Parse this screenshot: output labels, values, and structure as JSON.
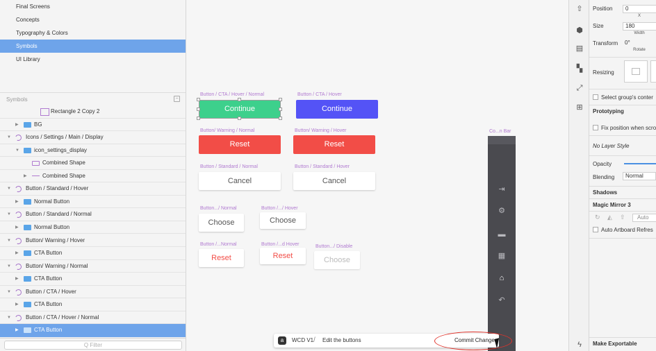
{
  "sidebar": {
    "pages": [
      {
        "label": "Final Screens",
        "selected": false
      },
      {
        "label": "Concepts",
        "selected": false
      },
      {
        "label": "Typography & Colors",
        "selected": false
      },
      {
        "label": "Symbols",
        "selected": true
      },
      {
        "label": "UI Library",
        "selected": false
      }
    ],
    "symbols_header": "Symbols",
    "layers": [
      {
        "label": "Rectangle 2 Copy 2",
        "indent": 3,
        "icon": "rectangle-icon",
        "arrow": "",
        "selected": false
      },
      {
        "label": "BG",
        "indent": 1,
        "icon": "folder-icon",
        "arrow": "▶",
        "selected": false
      },
      {
        "label": "Icons / Settings / Main / Display",
        "indent": 0,
        "icon": "symbol-icon",
        "arrow": "▼",
        "selected": false
      },
      {
        "label": "icon_settings_display",
        "indent": 1,
        "icon": "folder-icon",
        "arrow": "▼",
        "selected": false
      },
      {
        "label": "Combined Shape",
        "indent": 2,
        "icon": "shape-icon",
        "arrow": "",
        "selected": false
      },
      {
        "label": "Combined Shape",
        "indent": 2,
        "icon": "shape2-icon",
        "arrow": "▶",
        "selected": false
      },
      {
        "label": "Button / Standard / Hover",
        "indent": 0,
        "icon": "symbol-icon",
        "arrow": "▼",
        "selected": false
      },
      {
        "label": "Normal Button",
        "indent": 1,
        "icon": "folder-icon",
        "arrow": "▶",
        "selected": false
      },
      {
        "label": "Button / Standard / Normal",
        "indent": 0,
        "icon": "symbol-icon",
        "arrow": "▼",
        "selected": false
      },
      {
        "label": "Normal Button",
        "indent": 1,
        "icon": "folder-icon",
        "arrow": "▶",
        "selected": false
      },
      {
        "label": "Button/ Warning / Hover",
        "indent": 0,
        "icon": "symbol-icon",
        "arrow": "▼",
        "selected": false
      },
      {
        "label": "CTA Button",
        "indent": 1,
        "icon": "folder-icon",
        "arrow": "▶",
        "selected": false
      },
      {
        "label": "Button/ Warning / Normal",
        "indent": 0,
        "icon": "symbol-icon",
        "arrow": "▼",
        "selected": false
      },
      {
        "label": "CTA Button",
        "indent": 1,
        "icon": "folder-icon",
        "arrow": "▶",
        "selected": false
      },
      {
        "label": "Button / CTA / Hover",
        "indent": 0,
        "icon": "symbol-icon",
        "arrow": "▼",
        "selected": false
      },
      {
        "label": "CTA Button",
        "indent": 1,
        "icon": "folder-icon",
        "arrow": "▶",
        "selected": false
      },
      {
        "label": "Button / CTA / Hover / Normal",
        "indent": 0,
        "icon": "symbol-icon",
        "arrow": "▼",
        "selected": false
      },
      {
        "label": "CTA Button",
        "indent": 1,
        "icon": "folder-icon",
        "arrow": "▶",
        "selected": true
      }
    ],
    "filter_placeholder": "Q Filter"
  },
  "canvas": {
    "artboards": [
      {
        "caption": "Button / CTA / Hover / Normal",
        "label": "Continue",
        "style": "green"
      },
      {
        "caption": "Button / CTA / Hover",
        "label": "Continue",
        "style": "blue"
      },
      {
        "caption": "Button/ Warning / Normal",
        "label": "Reset",
        "style": "red"
      },
      {
        "caption": "Button/ Warning / Hover",
        "label": "Reset",
        "style": "red"
      },
      {
        "caption": "Button / Standard / Normal",
        "label": "Cancel",
        "style": "white"
      },
      {
        "caption": "Button / Standard / Hover",
        "label": "Cancel",
        "style": "white"
      },
      {
        "caption": "Button.../ Normal",
        "label": "Choose",
        "style": "white"
      },
      {
        "caption": "Button /.../ Hover",
        "label": "Choose",
        "style": "white"
      },
      {
        "caption": "Button /...Normal",
        "label": "Reset",
        "style": "white-red"
      },
      {
        "caption": "Button /...d Hover",
        "label": "Reset",
        "style": "white-red"
      },
      {
        "caption": "Button.../ Disable",
        "label": "Choose",
        "style": "disabled"
      }
    ],
    "bar_caption": "Co...n Bar",
    "bar_icons": [
      "login-icon",
      "gear-icon",
      "window-icon",
      "grid-icon",
      "home-icon",
      "back-icon"
    ],
    "bar_glyphs": [
      "⇥",
      "⚙",
      "▬",
      "▦",
      "⌂",
      "↶"
    ]
  },
  "commit_bar": {
    "project": "WCD V1",
    "separator": "/",
    "message": "Edit the buttons",
    "commit_label": "Commit Changes"
  },
  "toolbar_icons": [
    {
      "name": "share-icon",
      "glyph": "⇧"
    },
    {
      "name": "symbol-hex-icon",
      "glyph": "⬢"
    },
    {
      "name": "align-icon",
      "glyph": "▤"
    },
    {
      "name": "distribute-icon",
      "glyph": "▚"
    },
    {
      "name": "resize-icon",
      "glyph": "⤢"
    },
    {
      "name": "add-image-icon",
      "glyph": "⊞"
    },
    {
      "name": "lightning-icon",
      "glyph": "ϟ"
    }
  ],
  "inspector": {
    "position_label": "Position",
    "position_x": "0",
    "position_x_sub": "X",
    "size_label": "Size",
    "size_width": "180",
    "size_width_sub": "Width",
    "transform_label": "Transform",
    "rotate_value": "0°",
    "rotate_sub": "Rotate",
    "resizing_label": "Resizing",
    "select_group": "Select group's conter",
    "prototyping_header": "Prototyping",
    "fix_position": "Fix position when scro",
    "layer_style": "No Layer Style",
    "opacity_label": "Opacity",
    "blending_label": "Blending",
    "blending_value": "Normal",
    "shadows_header": "Shadows",
    "magic_mirror_header": "Magic Mirror 3",
    "magic_auto": "Auto",
    "auto_artboard": "Auto Artboard Refres",
    "make_exportable": "Make Exportable"
  },
  "colors": {
    "selection_blue": "#6ea4ea",
    "cta_green": "#3dd08c",
    "cta_blue": "#5453f6",
    "warning_red": "#f24d47",
    "symbol_purple": "#b07ad0"
  }
}
